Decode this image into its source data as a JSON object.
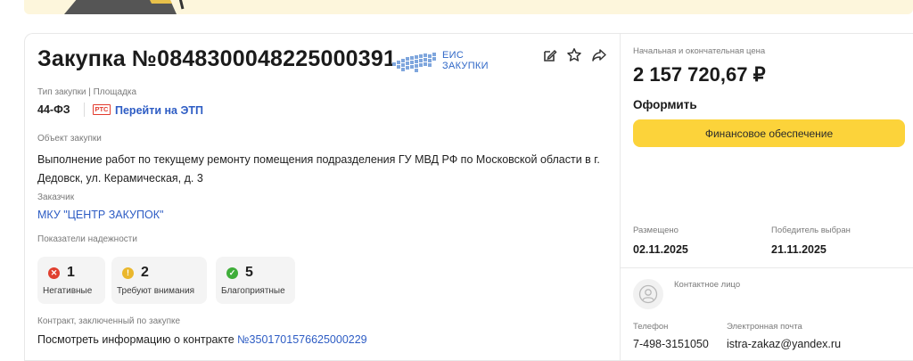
{
  "header": {
    "title": "Закупка №0848300048225000391",
    "eis_logo_line1": "ЕИС",
    "eis_logo_line2": "ЗАКУПКИ"
  },
  "actions": [
    "edit-icon",
    "star-icon",
    "share-icon"
  ],
  "procurement": {
    "type_label": "Тип закупки | Площадка",
    "law": "44-ФЗ",
    "platform_logo": "РТС",
    "platform_link": "Перейти на ЭТП",
    "object_label": "Объект закупки",
    "object_text": "Выполнение работ по текущему ремонту помещения подразделения ГУ МВД РФ по Московской области в г. Дедовск, ул. Керамическая, д. 3",
    "customer_label": "Заказчик",
    "customer_name": "МКУ \"ЦЕНТР ЗАКУПОК\"",
    "reliability_label": "Показатели надежности",
    "reliability": [
      {
        "count": "1",
        "label": "Негативные",
        "color": "#e0402f",
        "symbol": "✕"
      },
      {
        "count": "2",
        "label": "Требуют внимания",
        "color": "#eab72c",
        "symbol": "!"
      },
      {
        "count": "5",
        "label": "Благоприятные",
        "color": "#3fae3a",
        "symbol": "✓"
      }
    ],
    "contract_label": "Контракт, заключенный по закупке",
    "contract_text": "Посмотреть информацию о контракте",
    "contract_link": "№3501701576625000229"
  },
  "pricing": {
    "price_label": "Начальная и окончательная цена",
    "price": "2 157 720,67 ₽",
    "action_title": "Оформить",
    "button_label": "Финансовое обеспечение"
  },
  "dates": {
    "posted_label": "Размещено",
    "posted": "02.11.2025",
    "winner_label": "Победитель выбран",
    "winner_date": "21.11.2025"
  },
  "contact": {
    "label": "Контактное лицо",
    "phone_label": "Телефон",
    "phone": "7-498-3151050",
    "email_label": "Электронная почта",
    "email": "istra-zakaz@yandex.ru"
  },
  "colors": {
    "accent_button": "#fcd33a",
    "link": "#2d5cc4",
    "banner": "#fdf6dc"
  }
}
